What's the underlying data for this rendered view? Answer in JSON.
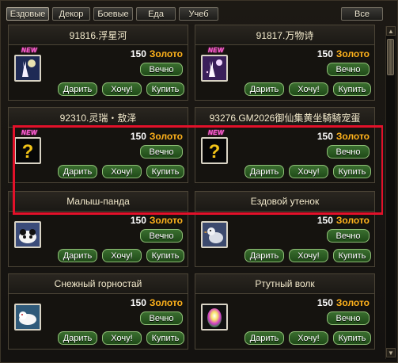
{
  "tabs": [
    {
      "label": "Ездовые",
      "active": true
    },
    {
      "label": "Декор",
      "active": false
    },
    {
      "label": "Боевые",
      "active": false
    },
    {
      "label": "Еда",
      "active": false
    },
    {
      "label": "Учеб",
      "active": false
    }
  ],
  "all_tab": "Все",
  "items": [
    {
      "title": "91816.浮星河",
      "price": "150",
      "currency": "Золото",
      "term": "Вечно",
      "new": true,
      "icon": "rabbit-night-icon"
    },
    {
      "title": "91817.万物诗",
      "price": "150",
      "currency": "Золото",
      "term": "Вечно",
      "new": true,
      "icon": "rabbit-night-icon"
    },
    {
      "title": "92310.灵瑞・敖泽",
      "price": "150",
      "currency": "Золото",
      "term": "Вечно",
      "new": true,
      "icon": "unknown-question-icon"
    },
    {
      "title": "93276.GM2026御仙集黄坐騎騎宠蛋",
      "price": "150",
      "currency": "Золото",
      "term": "Вечно",
      "new": true,
      "icon": "unknown-question-icon"
    },
    {
      "title": "Малыш-панда",
      "price": "150",
      "currency": "Золото",
      "term": "Вечно",
      "new": false,
      "icon": "panda-icon"
    },
    {
      "title": "Ездовой утенок",
      "price": "150",
      "currency": "Золото",
      "term": "Вечно",
      "new": false,
      "icon": "duckling-icon"
    },
    {
      "title": "Снежный горностай",
      "price": "150",
      "currency": "Золото",
      "term": "Вечно",
      "new": false,
      "icon": "snow-ermine-icon"
    },
    {
      "title": "Ртутный волк",
      "price": "150",
      "currency": "Золото",
      "term": "Вечно",
      "new": false,
      "icon": "egg-icon"
    }
  ],
  "labels": {
    "new_badge": "NEW",
    "gift": "Дарить",
    "want": "Хочу!",
    "buy": "Купить"
  },
  "colors": {
    "price": "#ffffff",
    "currency": "#ffb21b",
    "button_bg": "#2c5d24",
    "highlight": "#e2112a",
    "new_badge": "#ff5ad4"
  }
}
